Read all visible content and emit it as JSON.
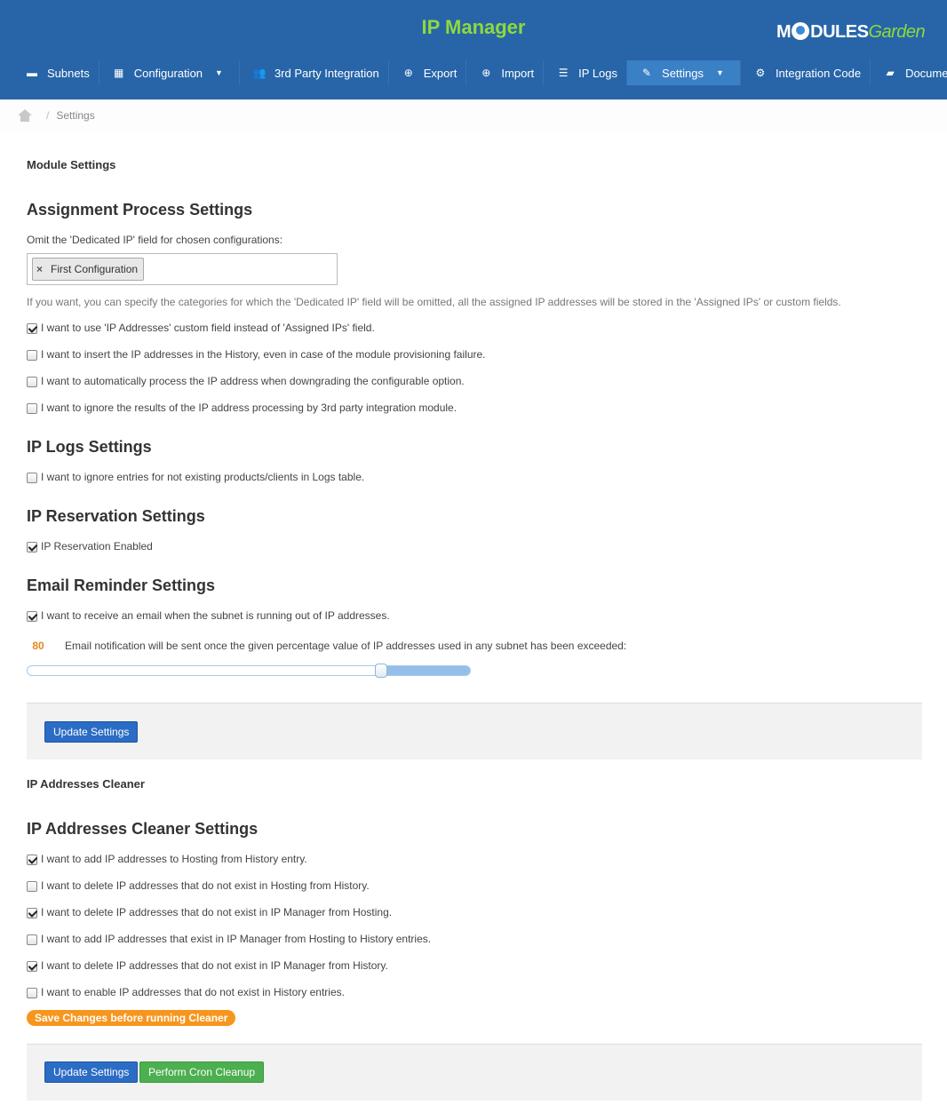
{
  "app": {
    "title": "IP Manager",
    "logo_main": "M",
    "logo_after": "DULES",
    "logo_garden": "Garden"
  },
  "nav": [
    {
      "label": "Subnets",
      "icon": "briefcase-icon",
      "glyph": "▬"
    },
    {
      "label": "Configuration",
      "icon": "grid-icon",
      "glyph": "▦",
      "dropdown": true
    },
    {
      "label": "3rd Party Integration",
      "icon": "users-icon",
      "glyph": "👥"
    },
    {
      "label": "Export",
      "icon": "export-icon",
      "glyph": "⊕"
    },
    {
      "label": "Import",
      "icon": "import-icon",
      "glyph": "⊕"
    },
    {
      "label": "IP Logs",
      "icon": "list-icon",
      "glyph": "☰"
    },
    {
      "label": "Settings",
      "icon": "wrench-icon",
      "glyph": "✎",
      "active": true,
      "dropdown": true
    },
    {
      "label": "Integration Code",
      "icon": "gears-icon",
      "glyph": "⚙"
    },
    {
      "label": "Documentation",
      "icon": "book-icon",
      "glyph": "▰"
    }
  ],
  "breadcrumb": {
    "current": "Settings",
    "separator": "/"
  },
  "module_settings": {
    "panel_title": "Module Settings",
    "assignment": {
      "title": "Assignment Process Settings",
      "omit_label": "Omit the 'Dedicated IP' field for chosen configurations:",
      "selected_tag": "First Configuration",
      "tag_remove": "×",
      "help": "If you want, you can specify the categories for which the 'Dedicated IP' field will be omitted, all the assigned IP addresses will be stored in the 'Assigned IPs' or custom fields.",
      "options": [
        {
          "label": "I want to use 'IP Addresses' custom field instead of 'Assigned IPs' field.",
          "checked": true
        },
        {
          "label": "I want to insert the IP addresses in the History, even in case of the module provisioning failure.",
          "checked": false
        },
        {
          "label": "I want to automatically process the IP address when downgrading the configurable option.",
          "checked": false
        },
        {
          "label": "I want to ignore the results of the IP address processing by 3rd party integration module.",
          "checked": false
        }
      ]
    },
    "logs": {
      "title": "IP Logs Settings",
      "options": [
        {
          "label": "I want to ignore entries for not existing products/clients in Logs table.",
          "checked": false
        }
      ]
    },
    "reservation": {
      "title": "IP Reservation Settings",
      "options": [
        {
          "label": "IP Reservation Enabled",
          "checked": true
        }
      ]
    },
    "email": {
      "title": "Email Reminder Settings",
      "options": [
        {
          "label": "I want to receive an email when the subnet is running out of IP addresses.",
          "checked": true
        }
      ],
      "percent_value": "80",
      "percent_fraction": 0.8,
      "percent_label": "Email notification will be sent once the given percentage value of IP addresses used in any subnet has been exceeded:"
    },
    "update_button": "Update Settings"
  },
  "cleaner": {
    "panel_title": "IP Addresses Cleaner",
    "title": "IP Addresses Cleaner Settings",
    "options": [
      {
        "label": "I want to add IP addresses to Hosting from History entry.",
        "checked": true
      },
      {
        "label": "I want to delete IP addresses that do not exist in Hosting from History.",
        "checked": false
      },
      {
        "label": "I want to delete IP addresses that do not exist in IP Manager from Hosting.",
        "checked": true
      },
      {
        "label": "I want to add IP addresses that exist in IP Manager from Hosting to History entries.",
        "checked": false
      },
      {
        "label": "I want to delete IP addresses that do not exist in IP Manager from History.",
        "checked": true
      },
      {
        "label": "I want to enable IP addresses that do not exist in History entries.",
        "checked": false
      }
    ],
    "warning": "Save Changes before running Cleaner",
    "update_button": "Update Settings",
    "cleanup_button": "Perform Cron Cleanup"
  }
}
